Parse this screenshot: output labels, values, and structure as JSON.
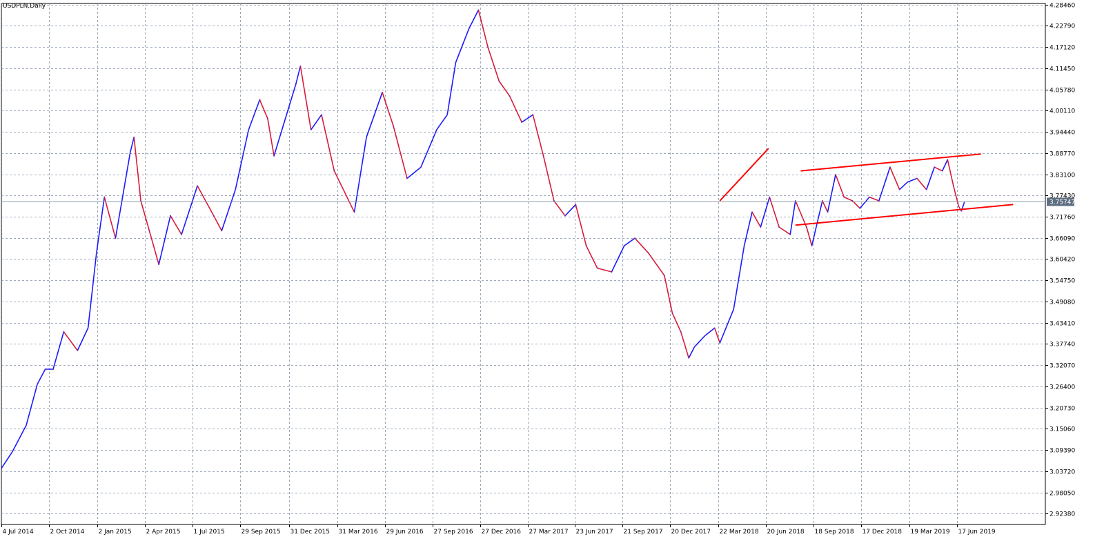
{
  "symbol_label": "USDPLN,Daily",
  "colors": {
    "background": "#ffffff",
    "grid": "#7f8fa6",
    "price_up": "#1a1aff",
    "price_down": "#d81b3a",
    "trendline": "#ff0000",
    "current_price_line": "#8a9bb0",
    "current_price_badge": "#5f6f82",
    "axis_text": "#000000"
  },
  "chart_data": {
    "type": "line",
    "title": "USDPLN,Daily",
    "xlabel": "",
    "ylabel": "",
    "ylim": [
      2.895,
      4.2875
    ],
    "current_price": 3.75747,
    "current_price_label": "3.75747",
    "y_ticks": [
      {
        "value": 4.2846,
        "label": "4.28460"
      },
      {
        "value": 4.2279,
        "label": "4.22790"
      },
      {
        "value": 4.1712,
        "label": "4.17120"
      },
      {
        "value": 4.1145,
        "label": "4.11450"
      },
      {
        "value": 4.0578,
        "label": "4.05780"
      },
      {
        "value": 4.0011,
        "label": "4.00110"
      },
      {
        "value": 3.9444,
        "label": "3.94440"
      },
      {
        "value": 3.8877,
        "label": "3.88770"
      },
      {
        "value": 3.831,
        "label": "3.83100"
      },
      {
        "value": 3.7743,
        "label": "3.77430"
      },
      {
        "value": 3.7176,
        "label": "3.71760"
      },
      {
        "value": 3.6609,
        "label": "3.66090"
      },
      {
        "value": 3.6042,
        "label": "3.60420"
      },
      {
        "value": 3.5475,
        "label": "3.54750"
      },
      {
        "value": 3.4908,
        "label": "3.49080"
      },
      {
        "value": 3.4341,
        "label": "3.43410"
      },
      {
        "value": 3.3774,
        "label": "3.37740"
      },
      {
        "value": 3.3207,
        "label": "3.32070"
      },
      {
        "value": 3.264,
        "label": "3.26400"
      },
      {
        "value": 3.2073,
        "label": "3.20730"
      },
      {
        "value": 3.1506,
        "label": "3.15060"
      },
      {
        "value": 3.0939,
        "label": "3.09390"
      },
      {
        "value": 3.0372,
        "label": "3.03720"
      },
      {
        "value": 2.9805,
        "label": "2.98050"
      },
      {
        "value": 2.9238,
        "label": "2.92380"
      }
    ],
    "x_ticks": [
      {
        "date": "2014-07-04",
        "label": "4 Jul 2014"
      },
      {
        "date": "2014-10-02",
        "label": "2 Oct 2014"
      },
      {
        "date": "2015-01-02",
        "label": "2 Jan 2015"
      },
      {
        "date": "2015-04-02",
        "label": "2 Apr 2015"
      },
      {
        "date": "2015-07-01",
        "label": "1 Jul 2015"
      },
      {
        "date": "2015-09-29",
        "label": "29 Sep 2015"
      },
      {
        "date": "2015-12-31",
        "label": "31 Dec 2015"
      },
      {
        "date": "2016-03-31",
        "label": "31 Mar 2016"
      },
      {
        "date": "2016-06-29",
        "label": "29 Jun 2016"
      },
      {
        "date": "2016-09-27",
        "label": "27 Sep 2016"
      },
      {
        "date": "2016-12-27",
        "label": "27 Dec 2016"
      },
      {
        "date": "2017-03-27",
        "label": "27 Mar 2017"
      },
      {
        "date": "2017-06-23",
        "label": "23 Jun 2017"
      },
      {
        "date": "2017-09-21",
        "label": "21 Sep 2017"
      },
      {
        "date": "2017-12-20",
        "label": "20 Dec 2017"
      },
      {
        "date": "2018-03-22",
        "label": "22 Mar 2018"
      },
      {
        "date": "2018-06-20",
        "label": "20 Jun 2018"
      },
      {
        "date": "2018-09-18",
        "label": "18 Sep 2018"
      },
      {
        "date": "2018-12-17",
        "label": "17 Dec 2018"
      },
      {
        "date": "2019-03-19",
        "label": "19 Mar 2019"
      },
      {
        "date": "2019-06-17",
        "label": "17 Jun 2019"
      }
    ],
    "series": [
      {
        "values": [
          {
            "date": "2014-07-04",
            "value": 3.045
          },
          {
            "date": "2014-07-25",
            "value": 3.09
          },
          {
            "date": "2014-08-20",
            "value": 3.16
          },
          {
            "date": "2014-09-10",
            "value": 3.27
          },
          {
            "date": "2014-09-25",
            "value": 3.31
          },
          {
            "date": "2014-10-10",
            "value": 3.31
          },
          {
            "date": "2014-10-30",
            "value": 3.41
          },
          {
            "date": "2014-11-25",
            "value": 3.36
          },
          {
            "date": "2014-12-15",
            "value": 3.42
          },
          {
            "date": "2014-12-31",
            "value": 3.62
          },
          {
            "date": "2015-01-15",
            "value": 3.77
          },
          {
            "date": "2015-02-05",
            "value": 3.66
          },
          {
            "date": "2015-03-05",
            "value": 3.89
          },
          {
            "date": "2015-03-12",
            "value": 3.93
          },
          {
            "date": "2015-03-25",
            "value": 3.76
          },
          {
            "date": "2015-04-10",
            "value": 3.68
          },
          {
            "date": "2015-04-28",
            "value": 3.59
          },
          {
            "date": "2015-05-20",
            "value": 3.72
          },
          {
            "date": "2015-06-10",
            "value": 3.67
          },
          {
            "date": "2015-07-10",
            "value": 3.8
          },
          {
            "date": "2015-08-10",
            "value": 3.72
          },
          {
            "date": "2015-08-25",
            "value": 3.68
          },
          {
            "date": "2015-09-20",
            "value": 3.79
          },
          {
            "date": "2015-10-15",
            "value": 3.95
          },
          {
            "date": "2015-11-05",
            "value": 4.03
          },
          {
            "date": "2015-11-20",
            "value": 3.98
          },
          {
            "date": "2015-12-02",
            "value": 3.88
          },
          {
            "date": "2016-01-12",
            "value": 4.07
          },
          {
            "date": "2016-01-21",
            "value": 4.12
          },
          {
            "date": "2016-02-10",
            "value": 3.95
          },
          {
            "date": "2016-03-01",
            "value": 3.99
          },
          {
            "date": "2016-03-25",
            "value": 3.84
          },
          {
            "date": "2016-05-02",
            "value": 3.73
          },
          {
            "date": "2016-05-25",
            "value": 3.93
          },
          {
            "date": "2016-06-24",
            "value": 4.05
          },
          {
            "date": "2016-07-15",
            "value": 3.96
          },
          {
            "date": "2016-08-10",
            "value": 3.82
          },
          {
            "date": "2016-09-05",
            "value": 3.85
          },
          {
            "date": "2016-10-05",
            "value": 3.95
          },
          {
            "date": "2016-10-25",
            "value": 3.99
          },
          {
            "date": "2016-11-10",
            "value": 4.13
          },
          {
            "date": "2016-12-05",
            "value": 4.22
          },
          {
            "date": "2016-12-23",
            "value": 4.27
          },
          {
            "date": "2017-01-10",
            "value": 4.17
          },
          {
            "date": "2017-01-31",
            "value": 4.08
          },
          {
            "date": "2017-02-20",
            "value": 4.04
          },
          {
            "date": "2017-03-15",
            "value": 3.97
          },
          {
            "date": "2017-04-05",
            "value": 3.99
          },
          {
            "date": "2017-04-25",
            "value": 3.88
          },
          {
            "date": "2017-05-15",
            "value": 3.76
          },
          {
            "date": "2017-06-05",
            "value": 3.72
          },
          {
            "date": "2017-06-25",
            "value": 3.75
          },
          {
            "date": "2017-07-15",
            "value": 3.64
          },
          {
            "date": "2017-08-05",
            "value": 3.58
          },
          {
            "date": "2017-09-01",
            "value": 3.57
          },
          {
            "date": "2017-09-25",
            "value": 3.64
          },
          {
            "date": "2017-10-15",
            "value": 3.66
          },
          {
            "date": "2017-11-10",
            "value": 3.62
          },
          {
            "date": "2017-12-10",
            "value": 3.56
          },
          {
            "date": "2017-12-25",
            "value": 3.46
          },
          {
            "date": "2018-01-10",
            "value": 3.41
          },
          {
            "date": "2018-01-25",
            "value": 3.34
          },
          {
            "date": "2018-02-05",
            "value": 3.37
          },
          {
            "date": "2018-02-25",
            "value": 3.4
          },
          {
            "date": "2018-03-15",
            "value": 3.42
          },
          {
            "date": "2018-03-25",
            "value": 3.38
          },
          {
            "date": "2018-04-20",
            "value": 3.47
          },
          {
            "date": "2018-05-10",
            "value": 3.64
          },
          {
            "date": "2018-05-25",
            "value": 3.73
          },
          {
            "date": "2018-06-10",
            "value": 3.69
          },
          {
            "date": "2018-06-27",
            "value": 3.77
          },
          {
            "date": "2018-07-15",
            "value": 3.69
          },
          {
            "date": "2018-08-05",
            "value": 3.67
          },
          {
            "date": "2018-08-15",
            "value": 3.76
          },
          {
            "date": "2018-09-05",
            "value": 3.69
          },
          {
            "date": "2018-09-15",
            "value": 3.64
          },
          {
            "date": "2018-09-25",
            "value": 3.7
          },
          {
            "date": "2018-10-05",
            "value": 3.76
          },
          {
            "date": "2018-10-15",
            "value": 3.73
          },
          {
            "date": "2018-10-30",
            "value": 3.83
          },
          {
            "date": "2018-11-15",
            "value": 3.77
          },
          {
            "date": "2018-12-01",
            "value": 3.76
          },
          {
            "date": "2018-12-15",
            "value": 3.74
          },
          {
            "date": "2019-01-02",
            "value": 3.77
          },
          {
            "date": "2019-01-20",
            "value": 3.76
          },
          {
            "date": "2019-02-10",
            "value": 3.85
          },
          {
            "date": "2019-02-28",
            "value": 3.79
          },
          {
            "date": "2019-03-15",
            "value": 3.81
          },
          {
            "date": "2019-04-02",
            "value": 3.82
          },
          {
            "date": "2019-04-20",
            "value": 3.79
          },
          {
            "date": "2019-05-05",
            "value": 3.85
          },
          {
            "date": "2019-05-20",
            "value": 3.84
          },
          {
            "date": "2019-05-30",
            "value": 3.87
          },
          {
            "date": "2019-06-10",
            "value": 3.8
          },
          {
            "date": "2019-06-20",
            "value": 3.745
          },
          {
            "date": "2019-06-25",
            "value": 3.733
          },
          {
            "date": "2019-07-01",
            "value": 3.757
          }
        ]
      }
    ],
    "trendlines": [
      {
        "from": {
          "date": "2018-03-25",
          "value": 3.76
        },
        "to": {
          "date": "2018-06-25",
          "value": 3.9
        }
      },
      {
        "from": {
          "date": "2018-08-25",
          "value": 3.84
        },
        "to": {
          "date": "2019-08-01",
          "value": 3.885
        }
      },
      {
        "from": {
          "date": "2018-08-15",
          "value": 3.695
        },
        "to": {
          "date": "2019-10-01",
          "value": 3.75
        }
      }
    ]
  }
}
